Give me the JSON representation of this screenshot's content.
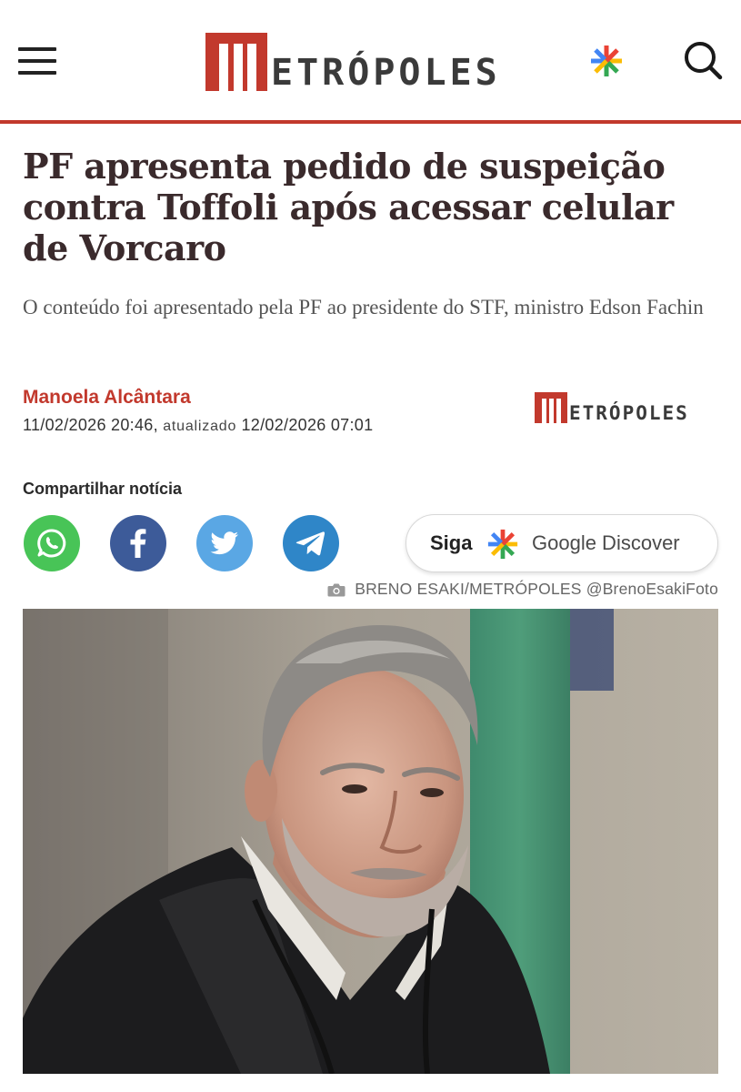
{
  "header": {
    "logo_text": "ETRÓPOLES",
    "logo_full": "METRÓPOLES"
  },
  "article": {
    "headline": "PF apresenta pedido de suspeição contra Toffoli após acessar celular de Vorcaro",
    "subtitle": "O conteúdo foi apresentado pela PF ao presidente do STF, ministro Edson Fachin",
    "author": "Manoela Alcântara",
    "published": "11/02/2026 20:46,",
    "updated_label": "atualizado",
    "updated": "12/02/2026 07:01",
    "brand_logo_text": "ETRÓPOLES"
  },
  "share": {
    "label": "Compartilhar notícia",
    "networks": [
      "whatsapp",
      "facebook",
      "twitter",
      "telegram"
    ]
  },
  "discover": {
    "siga": "Siga",
    "label": "Google Discover"
  },
  "photo": {
    "credit": "BRENO ESAKI/METRÓPOLES @BrenoEsakiFoto"
  },
  "colors": {
    "brand_red": "#c2392d",
    "headline": "#3a2a2c",
    "whatsapp": "#48c457",
    "facebook": "#3d5b99",
    "twitter": "#5aa7e4",
    "telegram": "#2f86c8"
  },
  "icons": [
    "menu-icon",
    "google-discover-star-icon",
    "search-icon",
    "whatsapp-icon",
    "facebook-icon",
    "twitter-icon",
    "telegram-icon",
    "camera-icon"
  ]
}
